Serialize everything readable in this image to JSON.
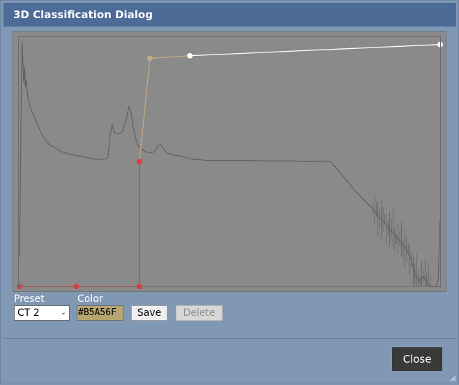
{
  "title": "3D Classification Dialog",
  "preset": {
    "label": "Preset",
    "value": "CT 2"
  },
  "color": {
    "label": "Color",
    "value": "#B5A56F",
    "swatch": "#b5a56f"
  },
  "buttons": {
    "save": "Save",
    "delete": "Delete",
    "close": "Close"
  },
  "colors": {
    "red_curve": "#e23b3b",
    "tan_curve": "#c4ab80",
    "white_curve": "#ffffff",
    "histogram": "#5f5f5f",
    "plot_bg": "#8a8a8a"
  },
  "chart_data": {
    "type": "line",
    "xlim": [
      0,
      1
    ],
    "ylim": [
      0,
      1
    ],
    "transfer_function": [
      {
        "x": 0.0,
        "y": 0.0,
        "color": "red"
      },
      {
        "x": 0.135,
        "y": 0.0,
        "color": "red"
      },
      {
        "x": 0.285,
        "y": 0.0,
        "color": "red"
      },
      {
        "x": 0.285,
        "y": 0.5,
        "color": "red"
      },
      {
        "x": 0.31,
        "y": 0.915,
        "color": "tan"
      },
      {
        "x": 0.405,
        "y": 0.925,
        "color": "white"
      },
      {
        "x": 1.0,
        "y": 0.97,
        "color": "white"
      }
    ],
    "histogram": [
      [
        0.0,
        0.12
      ],
      [
        0.002,
        0.4
      ],
      [
        0.004,
        0.75
      ],
      [
        0.006,
        0.98
      ],
      [
        0.008,
        0.9
      ],
      [
        0.01,
        0.82
      ],
      [
        0.012,
        0.88
      ],
      [
        0.014,
        0.8
      ],
      [
        0.016,
        0.83
      ],
      [
        0.018,
        0.79
      ],
      [
        0.02,
        0.76
      ],
      [
        0.025,
        0.72
      ],
      [
        0.03,
        0.7
      ],
      [
        0.04,
        0.66
      ],
      [
        0.05,
        0.62
      ],
      [
        0.06,
        0.59
      ],
      [
        0.07,
        0.57
      ],
      [
        0.08,
        0.56
      ],
      [
        0.1,
        0.54
      ],
      [
        0.12,
        0.53
      ],
      [
        0.15,
        0.52
      ],
      [
        0.18,
        0.51
      ],
      [
        0.2,
        0.51
      ],
      [
        0.21,
        0.515
      ],
      [
        0.215,
        0.6
      ],
      [
        0.22,
        0.65
      ],
      [
        0.225,
        0.62
      ],
      [
        0.235,
        0.61
      ],
      [
        0.245,
        0.62
      ],
      [
        0.255,
        0.68
      ],
      [
        0.26,
        0.72
      ],
      [
        0.265,
        0.7
      ],
      [
        0.27,
        0.64
      ],
      [
        0.28,
        0.57
      ],
      [
        0.29,
        0.55
      ],
      [
        0.3,
        0.54
      ],
      [
        0.31,
        0.535
      ],
      [
        0.32,
        0.54
      ],
      [
        0.33,
        0.565
      ],
      [
        0.335,
        0.57
      ],
      [
        0.34,
        0.56
      ],
      [
        0.35,
        0.535
      ],
      [
        0.37,
        0.525
      ],
      [
        0.38,
        0.525
      ],
      [
        0.39,
        0.52
      ],
      [
        0.41,
        0.51
      ],
      [
        0.45,
        0.505
      ],
      [
        0.5,
        0.505
      ],
      [
        0.55,
        0.505
      ],
      [
        0.6,
        0.503
      ],
      [
        0.65,
        0.503
      ],
      [
        0.7,
        0.5
      ],
      [
        0.72,
        0.503
      ],
      [
        0.74,
        0.5
      ],
      [
        0.75,
        0.48
      ],
      [
        0.76,
        0.46
      ],
      [
        0.78,
        0.42
      ],
      [
        0.8,
        0.38
      ],
      [
        0.82,
        0.345
      ],
      [
        0.84,
        0.31
      ],
      [
        0.86,
        0.27
      ],
      [
        0.88,
        0.23
      ],
      [
        0.9,
        0.19
      ],
      [
        0.92,
        0.15
      ],
      [
        0.93,
        0.11
      ],
      [
        0.94,
        0.05
      ],
      [
        0.95,
        0.02
      ],
      [
        0.96,
        0.04
      ],
      [
        0.97,
        0.01
      ],
      [
        0.98,
        0.0
      ],
      [
        0.99,
        0.0
      ],
      [
        0.995,
        0.02
      ],
      [
        1.0,
        0.27
      ]
    ]
  }
}
